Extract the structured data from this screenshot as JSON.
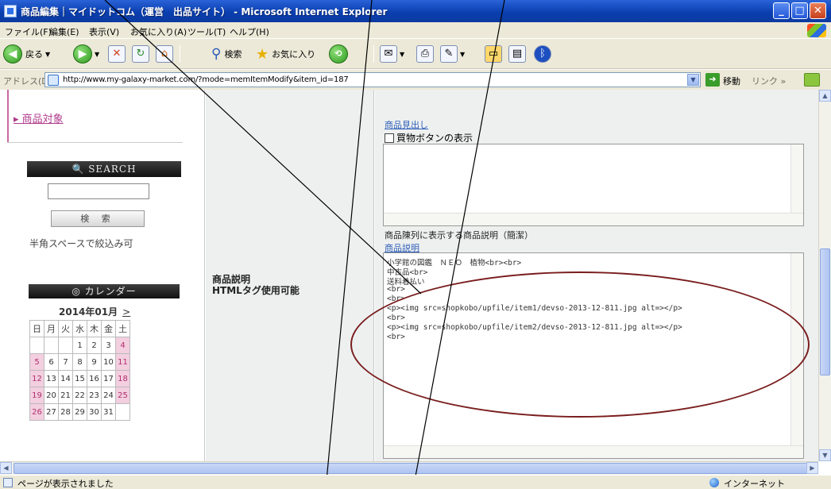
{
  "window": {
    "title": "商品編集｜マイドットコム（運営　出品サイト） - Microsoft Internet Explorer",
    "min_glyph": "_",
    "max_glyph": "□",
    "close_glyph": "✕"
  },
  "menu": [
    "ファイル(F)",
    "編集(E)",
    "表示(V)",
    "お気に入り(A)",
    "ツール(T)",
    "ヘルプ(H)"
  ],
  "toolbar": {
    "back_label": "戻る",
    "search_label": "検索",
    "favorites_label": "お気に入り"
  },
  "address": {
    "label": "アドレス(D)",
    "url": "http://www.my-galaxy-market.com/?mode=memItemModify&item_id=187",
    "go_label": "移動",
    "links_label": "リンク »"
  },
  "sidebar": {
    "category_link": "▸ 商品対象",
    "search_header": "🔍 SEARCH",
    "search_button": "検 索",
    "search_hint": "半角スペースで絞込み可",
    "calendar_header": "◎ カレンダー",
    "calendar_month": "2014年01月",
    "calendar_next": ">",
    "calendar_weekdays": [
      "日",
      "月",
      "火",
      "水",
      "木",
      "金",
      "土"
    ],
    "calendar_weeks": [
      [
        "",
        "",
        "",
        "1",
        "2",
        "3",
        "4"
      ],
      [
        "5",
        "6",
        "7",
        "8",
        "9",
        "10",
        "11"
      ],
      [
        "12",
        "13",
        "14",
        "15",
        "16",
        "17",
        "18"
      ],
      [
        "19",
        "20",
        "21",
        "22",
        "23",
        "24",
        "25"
      ],
      [
        "26",
        "27",
        "28",
        "29",
        "30",
        "31",
        ""
      ]
    ]
  },
  "form": {
    "field_label_line1": "商品説明",
    "field_label_line2": "HTMLタグ使用可能",
    "heading_link": "商品見出し",
    "checkbox_label": "買物ボタンの表示",
    "list_note": "商品陳列に表示する商品説明（簡潔）",
    "desc_link": "商品説明",
    "desc_lines": [
      "小学館の図鑑　ＮＥＯ　植物<br><br>",
      "中古品<br>",
      "送料着払い",
      "<br>",
      "<br>",
      "<p><img src=shopkobo/upfile/item1/devso-2013-12-811.jpg alt=></p>",
      "<br>",
      "<p><img src=shopkobo/upfile/item2/devso-2013-12-811.jpg alt=></p>",
      "<br>"
    ]
  },
  "status": {
    "text": "ページが表示されました",
    "zone": "インターネット"
  }
}
